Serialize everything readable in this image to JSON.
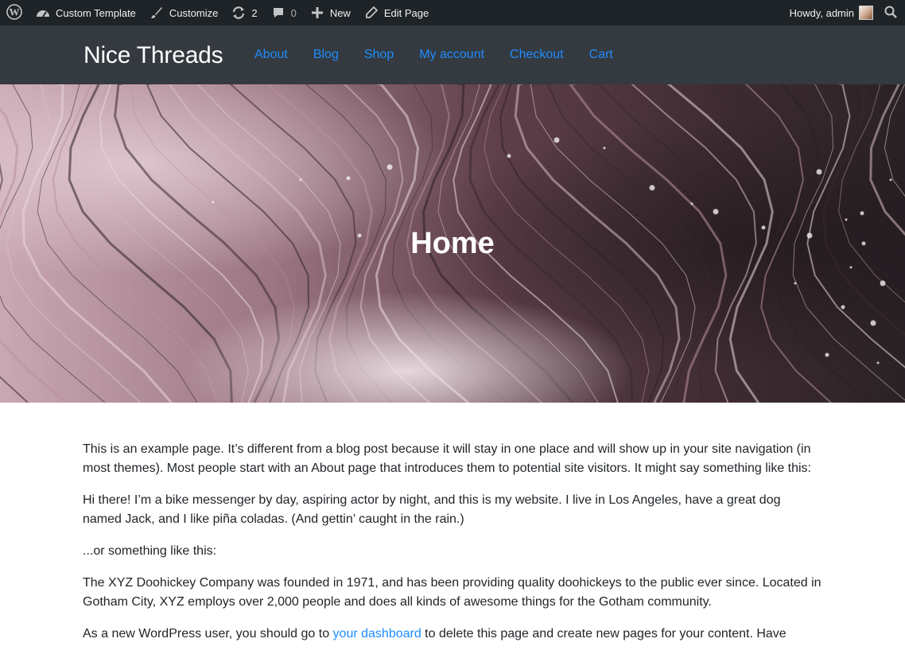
{
  "adminbar": {
    "site_name": "Custom Template",
    "customize": "Customize",
    "updates_count": "2",
    "comments_count": "0",
    "new_label": "New",
    "edit_page": "Edit Page",
    "greeting": "Howdy, admin",
    "icons": [
      "wordpress-icon",
      "dashboard-icon",
      "brush-icon",
      "updates-icon",
      "comment-icon",
      "plus-icon",
      "edit-icon",
      "search-icon"
    ]
  },
  "header": {
    "brand": "Nice Threads",
    "nav": [
      "About",
      "Blog",
      "Shop",
      "My account",
      "Checkout",
      "Cart"
    ]
  },
  "hero": {
    "title": "Home"
  },
  "content": {
    "p1": "This is an example page. It’s different from a blog post because it will stay in one place and will show up in your site navigation (in most themes). Most people start with an About page that introduces them to potential site visitors. It might say something like this:",
    "p2": "Hi there! I’m a bike messenger by day, aspiring actor by night, and this is my website. I live in Los Angeles, have a great dog named Jack, and I like piña coladas. (And gettin’ caught in the rain.)",
    "p3": "...or something like this:",
    "p4": "The XYZ Doohickey Company was founded in 1971, and has been providing quality doohickeys to the public ever since. Located in Gotham City, XYZ employs over 2,000 people and does all kinds of awesome things for the Gotham community.",
    "p5_before": "As a new WordPress user, you should go to ",
    "p5_link": "your dashboard",
    "p5_after": " to delete this page and create new pages for your content. Have"
  },
  "colors": {
    "adminbar_bg": "#1d2327",
    "header_bg": "#343a40",
    "link": "#1e8cff"
  }
}
